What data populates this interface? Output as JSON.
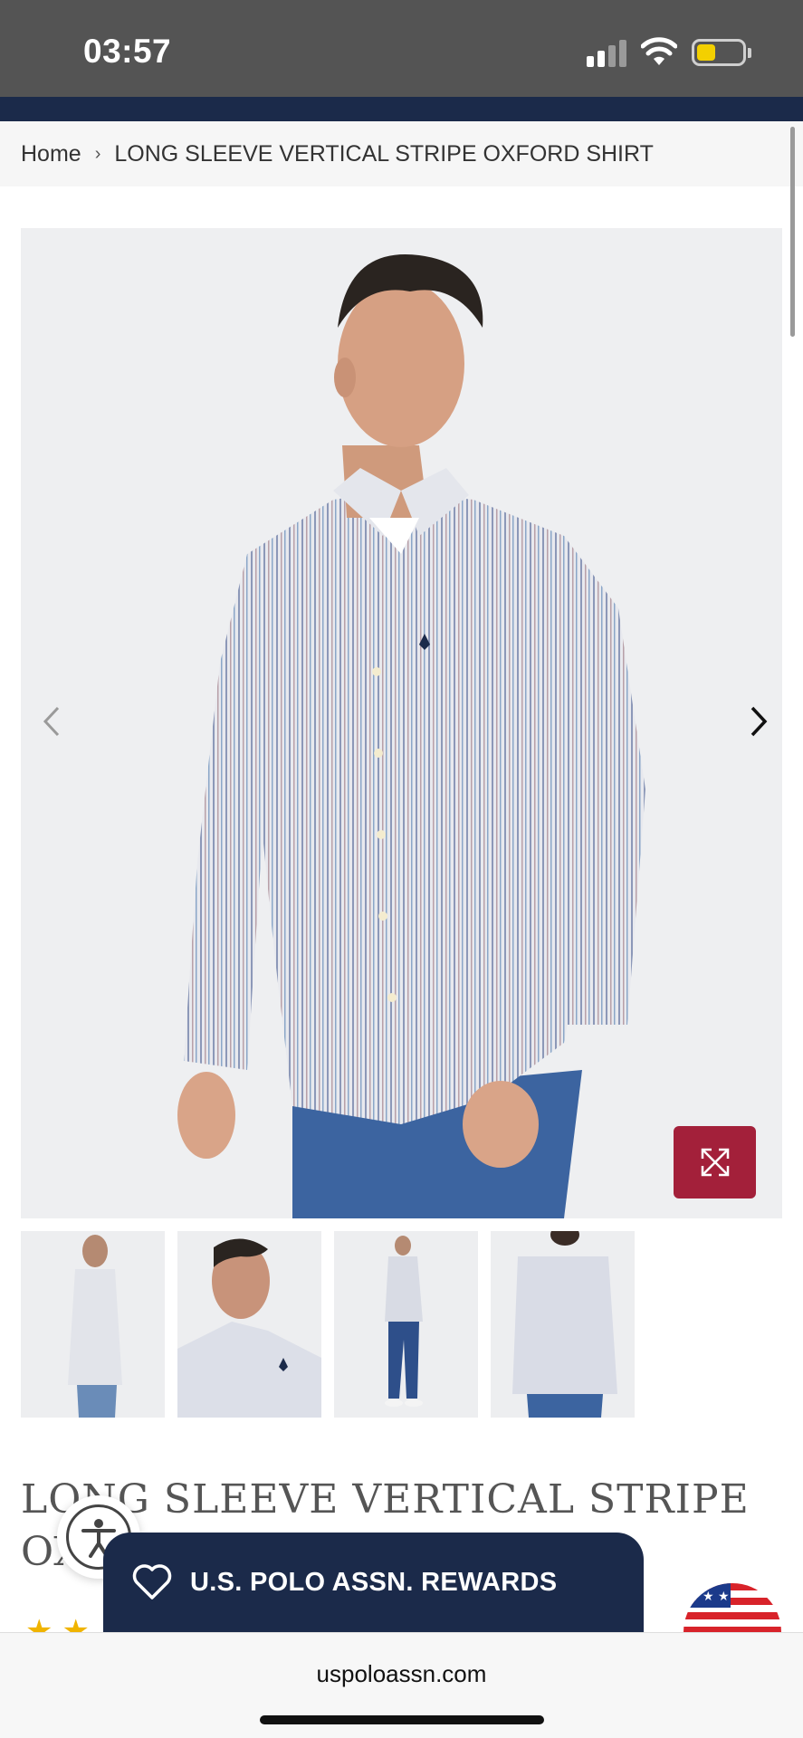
{
  "status_bar": {
    "time": "03:57"
  },
  "breadcrumb": {
    "home": "Home",
    "separator": "›",
    "current": "LONG SLEEVE VERTICAL STRIPE OXFORD SHIRT"
  },
  "gallery": {
    "prev_icon": "chevron-left-icon",
    "next_icon": "chevron-right-icon",
    "expand_icon": "expand-icon",
    "thumbnail_count": 4
  },
  "product": {
    "title": "LONG SLEEVE VERTICAL STRIPE OXFORD SHIRT",
    "rating_stars": "★★"
  },
  "rewards": {
    "label": "U.S. POLO ASSN. REWARDS",
    "icon": "heart-icon"
  },
  "browser": {
    "url": "uspoloassn.com"
  },
  "colors": {
    "navy": "#1b2a4a",
    "accent_red": "#a3203a",
    "status_bar": "#545454"
  }
}
